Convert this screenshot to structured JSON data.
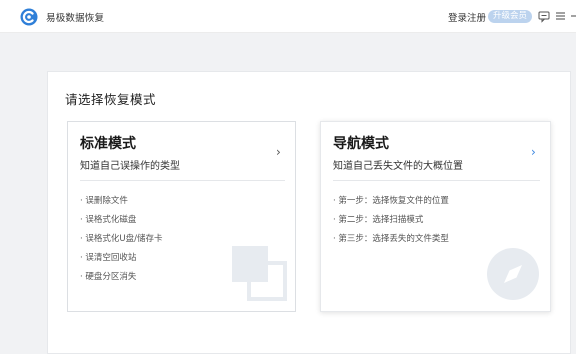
{
  "app": {
    "title": "易极数据恢复",
    "login_label": "登录注册",
    "upgrade_label": "升级会员"
  },
  "colors": {
    "accent": "#3b86e0",
    "badge_bg": "#bcd3ee",
    "content_bg": "#f1f2f4"
  },
  "icons": {
    "logo": "app-logo-icon",
    "feedback": "feedback-icon",
    "menu": "menu-icon",
    "minimize": "minimize-icon"
  },
  "main": {
    "heading": "请选择恢复模式",
    "cards": [
      {
        "title": "标准模式",
        "subtitle": "知道自己误操作的类型",
        "arrow": "›",
        "items": [
          "· 误删除文件",
          "· 误格式化磁盘",
          "· 误格式化U盘/储存卡",
          "· 误清空回收站",
          "· 硬盘分区消失"
        ]
      },
      {
        "title": "导航模式",
        "subtitle": "知道自己丢失文件的大概位置",
        "arrow": "›",
        "items": [
          "· 第一步：选择恢复文件的位置",
          "· 第二步：选择扫描模式",
          "· 第三步：选择丢失的文件类型"
        ]
      }
    ]
  }
}
